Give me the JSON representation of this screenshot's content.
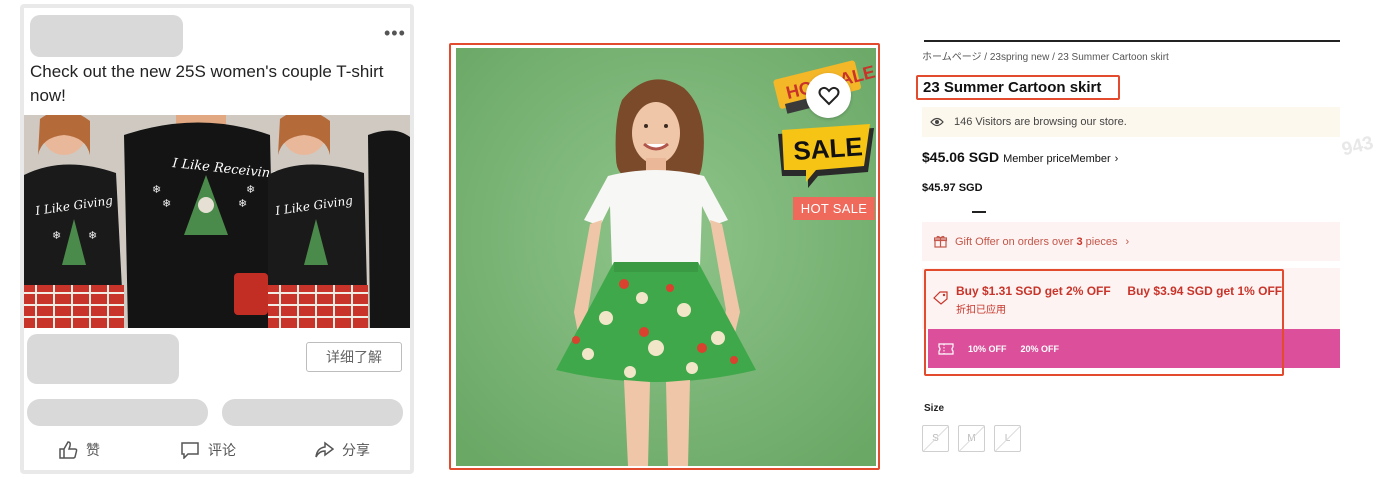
{
  "feed": {
    "post_text": "Check out the new 25S women's couple T-shirt now!",
    "cta_label": "详细了解",
    "actions": [
      {
        "icon": "thumbs-up-icon",
        "label": "赞"
      },
      {
        "icon": "comment-icon",
        "label": "评论"
      },
      {
        "icon": "share-icon",
        "label": "分享"
      }
    ],
    "shirt_texts": [
      "I Like Giving",
      "I Like Receiving",
      "I Like Giving"
    ]
  },
  "product_image": {
    "badges": {
      "hot": "HOT SALE",
      "sale": "SALE",
      "ribbon": "HOT SALE"
    }
  },
  "product": {
    "breadcrumb": "ホームページ / 23spring new / 23 Summer Cartoon skirt",
    "title": "23 Summer Cartoon skirt",
    "visitors_text": "146 Visitors are browsing our store.",
    "price": "$45.06 SGD",
    "member_price_label": "Member priceMember",
    "second_price": "$45.97 SGD",
    "gift_text_prefix": "Gift Offer on orders over",
    "gift_count": "3",
    "gift_text_suffix": "pieces",
    "discount_1": "Buy $1.31 SGD get 2% OFF",
    "discount_2": "Buy $3.94 SGD get 1% OFF",
    "discount_applied": "折扣已应用",
    "coupons": [
      "10% OFF",
      "20% OFF"
    ],
    "size_label": "Size",
    "sizes": [
      "S",
      "M",
      "L"
    ]
  },
  "watermark": "943",
  "colors": {
    "highlight_border": "#e34b2f",
    "coupon_bar": "#db4f9b",
    "discount_text": "#c8342a",
    "hot_sale_tag": "#f06a5b",
    "backdrop_green": "#7fba7a"
  }
}
